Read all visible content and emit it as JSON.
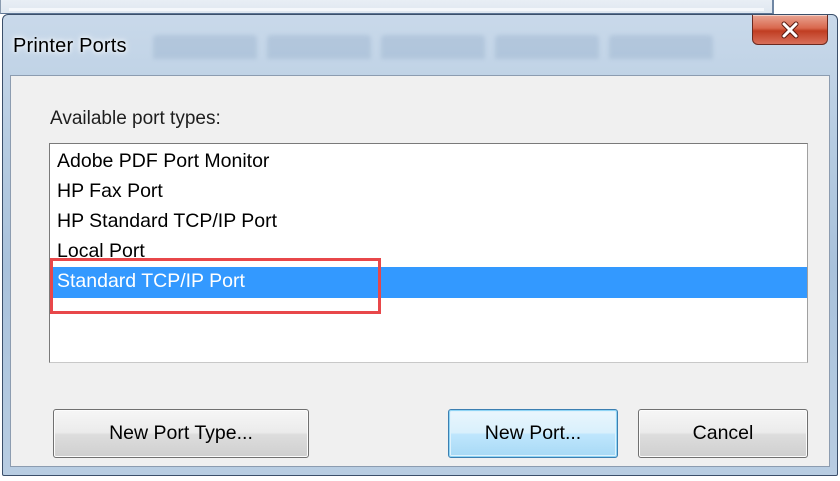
{
  "dialog": {
    "title": "Printer Ports",
    "close_icon": "close-x-icon",
    "close_color": "#c8432a"
  },
  "port_types": {
    "label": "Available port types:",
    "items": [
      {
        "label": "Adobe PDF Port Monitor",
        "selected": false
      },
      {
        "label": "HP Fax Port",
        "selected": false
      },
      {
        "label": "HP Standard TCP/IP Port",
        "selected": false
      },
      {
        "label": "Local Port",
        "selected": false
      },
      {
        "label": "Standard TCP/IP Port",
        "selected": true
      }
    ],
    "selection_color": "#3399ff",
    "annotation_color": "#e8474a"
  },
  "buttons": {
    "new_port_type": "New Port Type...",
    "new_port": "New Port...",
    "cancel": "Cancel"
  }
}
